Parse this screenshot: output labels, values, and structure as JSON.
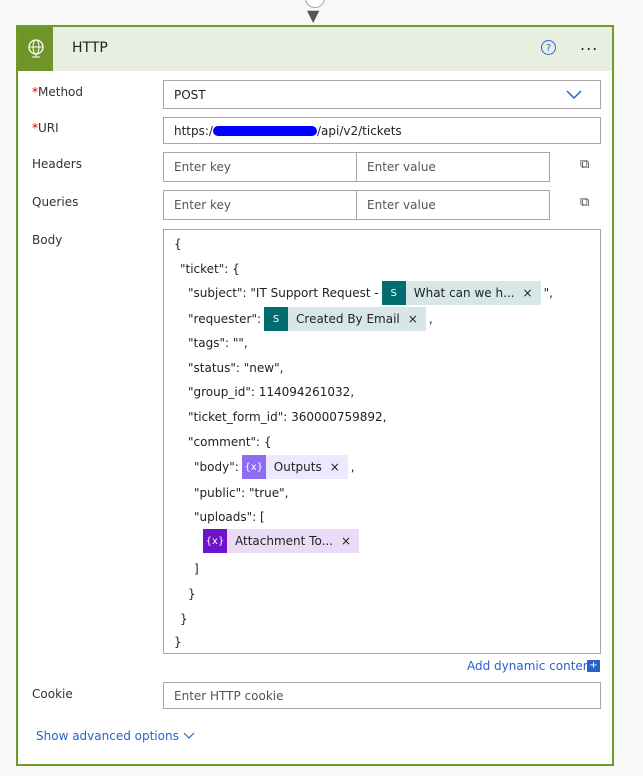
{
  "card": {
    "title": "HTTP",
    "help_icon": "?",
    "more_icon": "..."
  },
  "fields": {
    "method": {
      "label": "Method",
      "required": "*",
      "value": "POST"
    },
    "uri": {
      "label": "URI",
      "required": "*",
      "value_prefix": "https:/",
      "value_suffix": "/api/v2/tickets"
    },
    "headers": {
      "label": "Headers",
      "key_placeholder": "Enter key",
      "value_placeholder": "Enter value"
    },
    "queries": {
      "label": "Queries",
      "key_placeholder": "Enter key",
      "value_placeholder": "Enter value"
    },
    "body": {
      "label": "Body"
    },
    "cookie": {
      "label": "Cookie",
      "placeholder": "Enter HTTP cookie"
    }
  },
  "body_lines": {
    "l0": "{",
    "l1": "\"ticket\": {",
    "l2": "\"subject\": \"IT Support Request - ",
    "l2b": "\",",
    "l3": "\"requester\":",
    "l3b": ",",
    "l4": "\"tags\": \"\",",
    "l5": "\"status\": \"new\",",
    "l6": "\"group_id\": 114094261032,",
    "l7": "\"ticket_form_id\": 360000759892,",
    "l8": "\"comment\": {",
    "l9": "\"body\":",
    "l9b": ",",
    "l10": "\"public\": \"true\",",
    "l11": "\"uploads\": [",
    "l13": "]",
    "l14": "}",
    "l15": "}",
    "l16": "}"
  },
  "tokens": {
    "what": "What can we h...",
    "created": "Created By Email",
    "outputs": "Outputs",
    "attach": "Attachment To...",
    "close": "×",
    "expr_icon": "{x}"
  },
  "add_dynamic": "Add dynamic content",
  "add_dynamic_icon": "+",
  "advanced": "Show advanced options"
}
